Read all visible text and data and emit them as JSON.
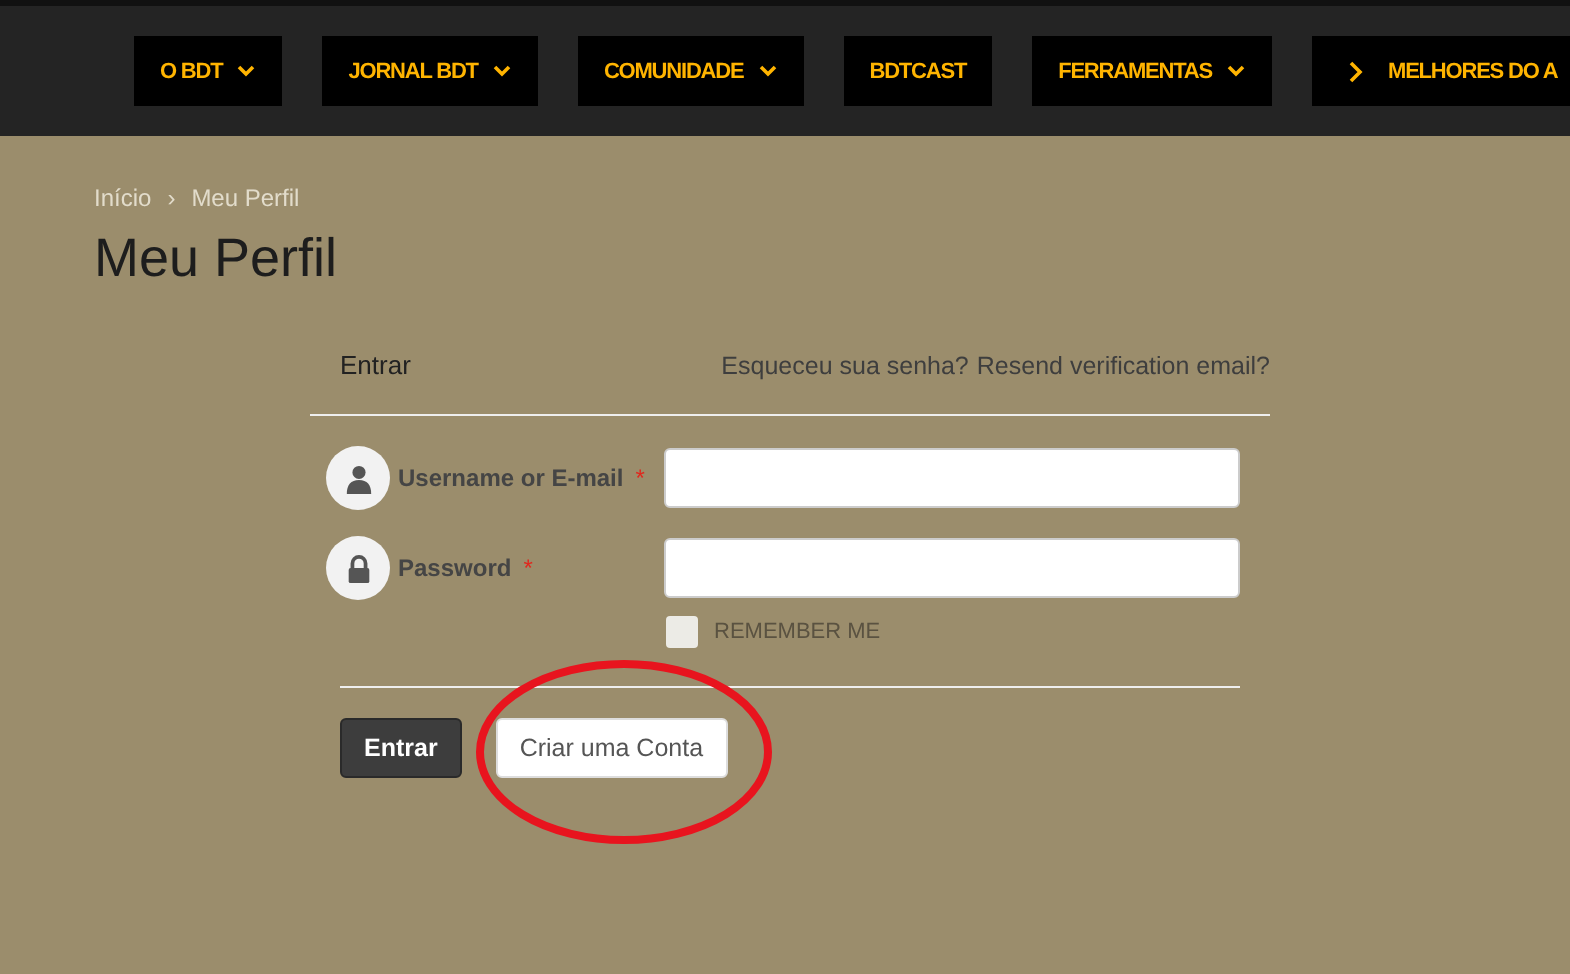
{
  "nav": [
    {
      "label": "O BDT",
      "kind": "menu"
    },
    {
      "label": "JORNAL BDT",
      "kind": "menu"
    },
    {
      "label": "COMUNIDADE",
      "kind": "menu"
    },
    {
      "label": "BDTCAST",
      "kind": "link"
    },
    {
      "label": "FERRAMENTAS",
      "kind": "menu"
    },
    {
      "label": "MELHORES DO A",
      "kind": "arrow"
    }
  ],
  "breadcrumb": [
    "Início",
    "Meu Perfil"
  ],
  "breadcrumb_separator": "›",
  "title": "Meu Perfil",
  "form": {
    "tab": "Entrar",
    "links": [
      "Esqueceu sua senha?",
      "Resend verification email?"
    ],
    "fields": [
      {
        "label": "Username or E-mail",
        "required": "*",
        "kind": "user"
      },
      {
        "label": "Password",
        "required": "*",
        "kind": "password"
      }
    ],
    "remember": {
      "label": "REMEMBER ME",
      "checked": false
    },
    "buttons": [
      {
        "label": "Entrar",
        "kind": "primary"
      },
      {
        "label": "Criar uma Conta",
        "kind": "secondary",
        "circled": true
      }
    ]
  }
}
